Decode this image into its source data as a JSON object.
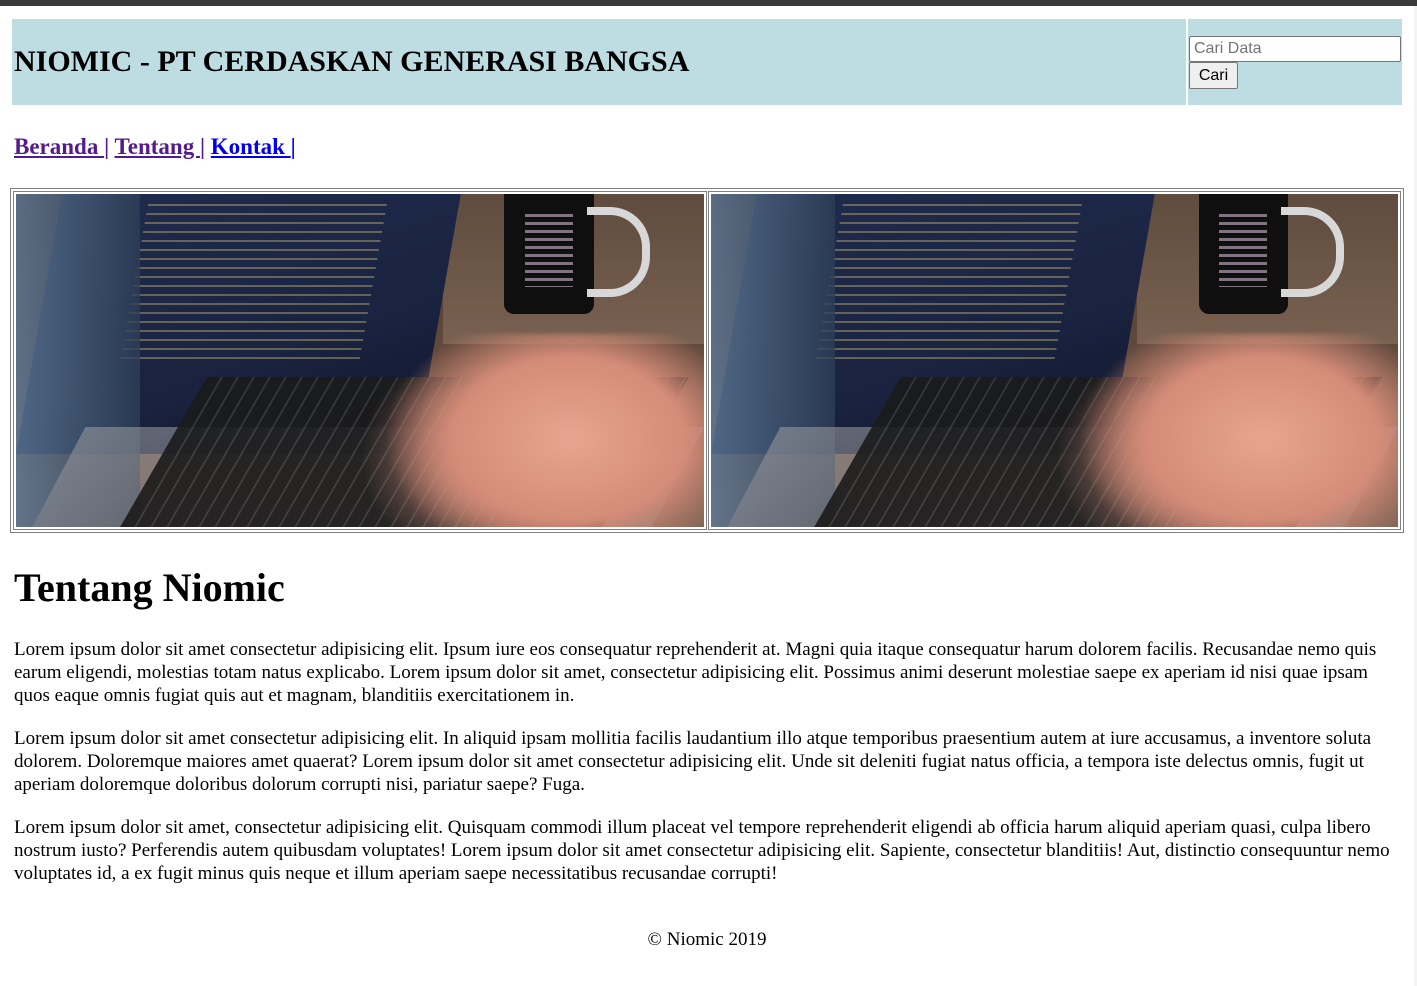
{
  "header": {
    "title": "NIOMIC - PT CERDASKAN GENERASI BANGSA",
    "search_placeholder": "Cari Data",
    "search_value": "",
    "search_button_label": "Cari"
  },
  "nav": {
    "items": [
      {
        "label": "Beranda ",
        "separator": "|"
      },
      {
        "label": "Tentang ",
        "separator": "|"
      },
      {
        "label": "Kontak ",
        "separator": "|"
      }
    ]
  },
  "gallery": {
    "images": [
      {
        "icon": "laptop-coding-photo"
      },
      {
        "icon": "laptop-coding-photo"
      }
    ]
  },
  "about": {
    "title": "Tentang Niomic",
    "paragraphs": [
      "Lorem ipsum dolor sit amet consectetur adipisicing elit. Ipsum iure eos consequatur reprehenderit at. Magni quia itaque consequatur harum dolorem facilis. Recusandae nemo quis earum eligendi, molestias totam natus explicabo. Lorem ipsum dolor sit amet, consectetur adipisicing elit. Possimus animi deserunt molestiae saepe ex aperiam id nisi quae ipsam quos eaque omnis fugiat quis aut et magnam, blanditiis exercitationem in.",
      "Lorem ipsum dolor sit amet consectetur adipisicing elit. In aliquid ipsam mollitia facilis laudantium illo atque temporibus praesentium autem at iure accusamus, a inventore soluta dolorem. Doloremque maiores amet quaerat? Lorem ipsum dolor sit amet consectetur adipisicing elit. Unde sit deleniti fugiat natus officia, a tempora iste delectus omnis, fugit ut aperiam doloremque doloribus dolorum corrupti nisi, pariatur saepe? Fuga.",
      "Lorem ipsum dolor sit amet, consectetur adipisicing elit. Quisquam commodi illum placeat vel tempore reprehenderit eligendi ab officia harum aliquid aperiam quasi, culpa libero nostrum iusto? Perferendis autem quibusdam voluptates! Lorem ipsum dolor sit amet consectetur adipisicing elit. Sapiente, consectetur blanditiis! Aut, distinctio consequuntur nemo voluptates id, a ex fugit minus quis neque et illum aperiam saepe necessitatibus recusandae corrupti!"
    ]
  },
  "footer": {
    "text": "© Niomic 2019"
  },
  "colors": {
    "header_bg": "#bddde3",
    "link_visited": "#551a8b",
    "link_unvisited": "#0000ee"
  }
}
